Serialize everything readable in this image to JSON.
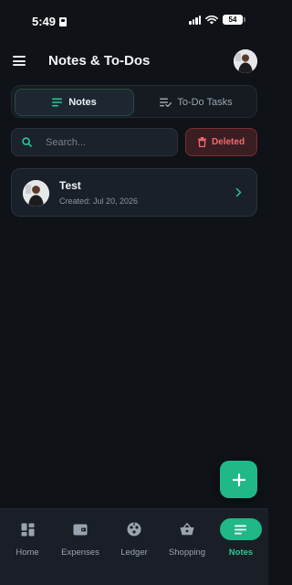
{
  "status_bar": {
    "time": "5:49",
    "battery": "54"
  },
  "header": {
    "title": "Notes & To-Dos"
  },
  "tabs": [
    {
      "label": "Notes",
      "active": true
    },
    {
      "label": "To-Do Tasks",
      "active": false
    }
  ],
  "search": {
    "placeholder": "Search...",
    "value": ""
  },
  "deleted_button": {
    "label": "Deleted"
  },
  "notes": [
    {
      "title": "Test",
      "created": "Created: Jul 20, 2026"
    }
  ],
  "bottom_nav": [
    {
      "label": "Home",
      "icon": "dashboard-icon",
      "active": false
    },
    {
      "label": "Expenses",
      "icon": "wallet-icon",
      "active": false
    },
    {
      "label": "Ledger",
      "icon": "ledger-icon",
      "active": false
    },
    {
      "label": "Shopping",
      "icon": "basket-icon",
      "active": false
    },
    {
      "label": "Notes",
      "icon": "notes-icon",
      "active": true
    }
  ],
  "colors": {
    "accent": "#20b887",
    "danger": "#f16b6f",
    "background": "#0f1217"
  }
}
